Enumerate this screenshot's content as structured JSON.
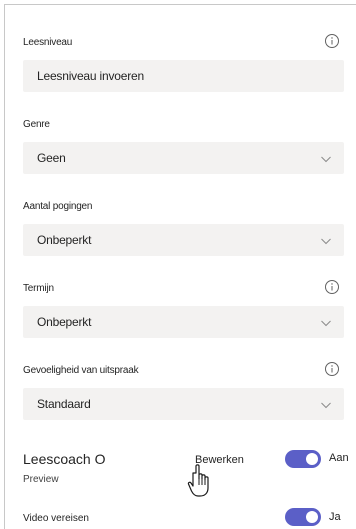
{
  "fields": [
    {
      "label": "Leesniveau",
      "value": "Leesniveau invoeren",
      "has_info": true,
      "has_chevron": false
    },
    {
      "label": "Genre",
      "value": "Geen",
      "has_info": false,
      "has_chevron": true
    },
    {
      "label": "Aantal pogingen",
      "value": "Onbeperkt",
      "has_info": false,
      "has_chevron": true
    },
    {
      "label": "Termijn",
      "value": "Onbeperkt",
      "has_info": true,
      "has_chevron": true
    },
    {
      "label": "Gevoeligheid van uitspraak",
      "value": "Standaard",
      "has_info": true,
      "has_chevron": true
    }
  ],
  "leescoach": {
    "title": "Leescoach O",
    "subtitle": "Preview",
    "edit_label": "Bewerken",
    "toggle_label": "Aan",
    "toggle_on": true
  },
  "video": {
    "label": "Video vereisen",
    "toggle_label": "Ja",
    "toggle_on": true
  },
  "colors": {
    "accent": "#5b5fc7",
    "field_bg": "#f3f2f1"
  },
  "icons": [
    "info-icon",
    "chevron-down-icon",
    "hand-cursor-icon"
  ]
}
